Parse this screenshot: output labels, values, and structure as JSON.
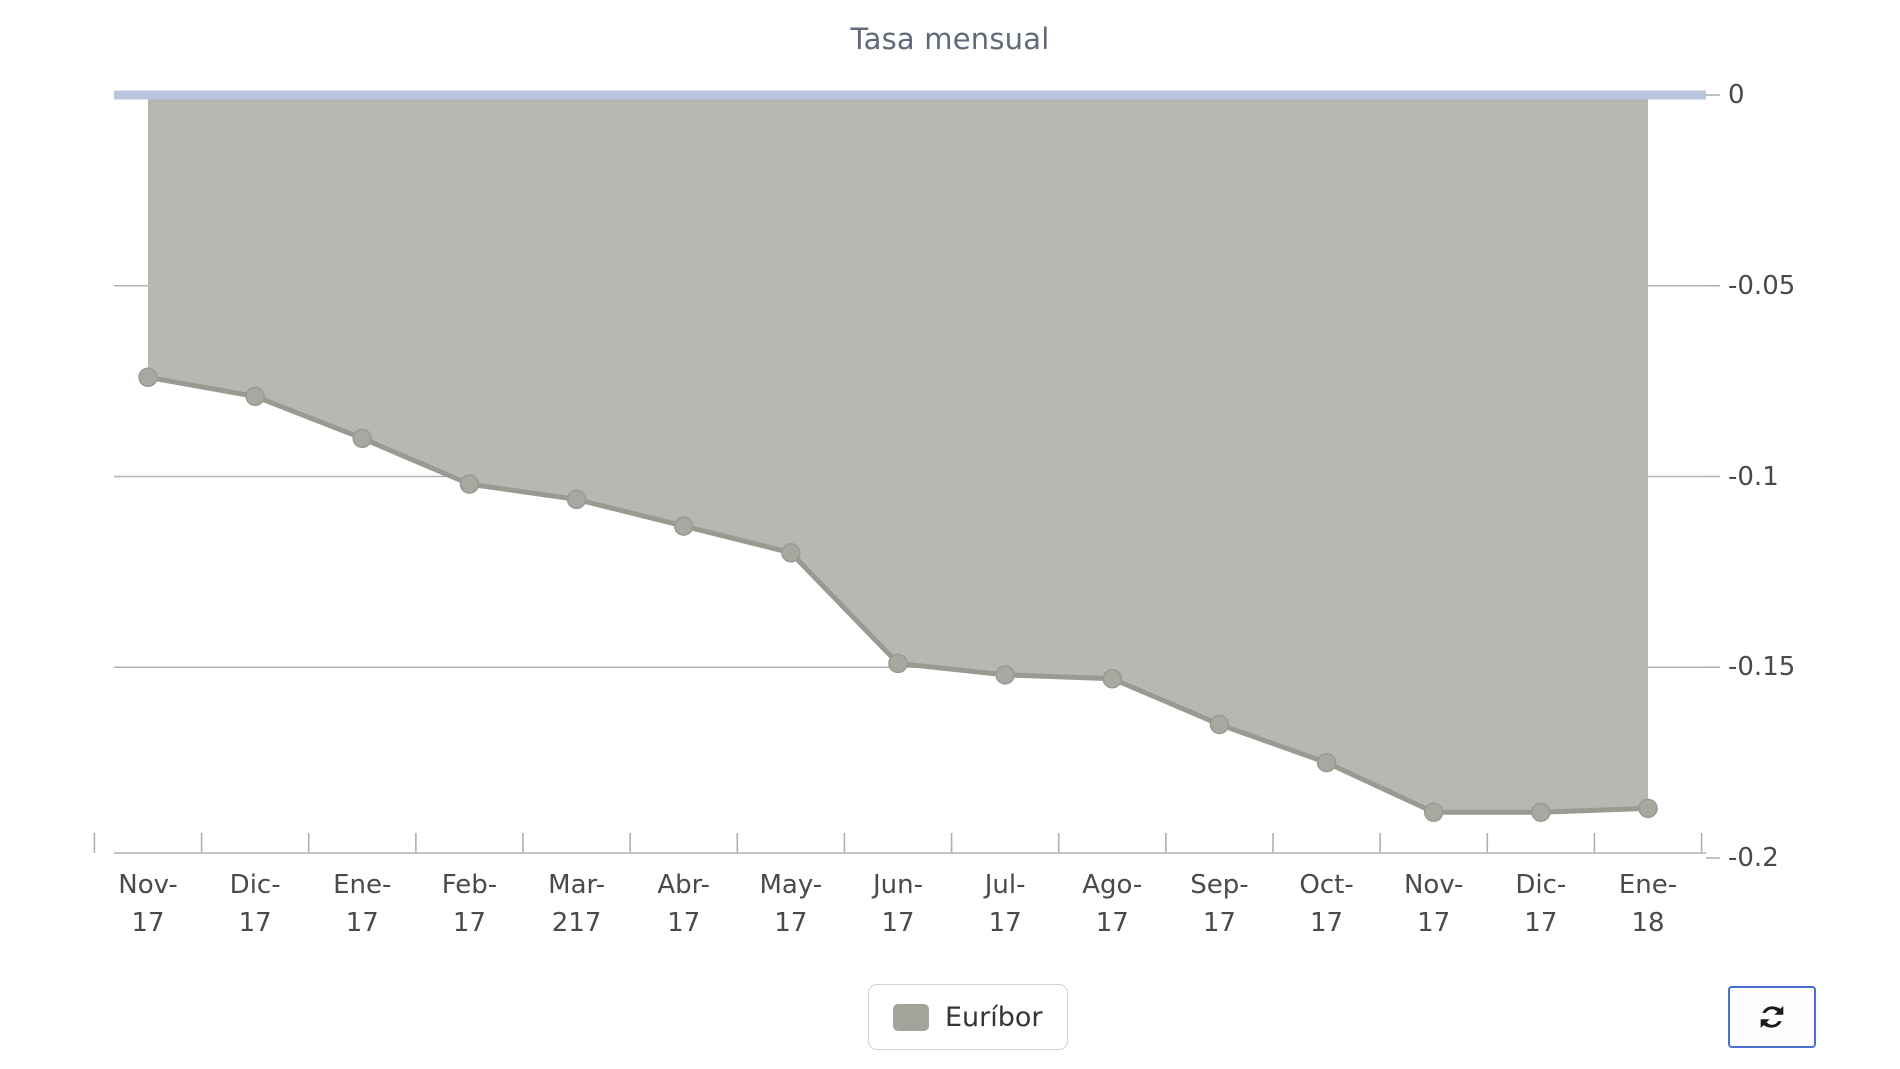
{
  "chart_data": {
    "type": "area",
    "title": "Tasa mensual",
    "xlabel": "",
    "ylabel": "",
    "grid": true,
    "legend_position": "bottom-center",
    "ylim": [
      -0.2,
      0
    ],
    "yticks": [
      "0",
      "-0.05",
      "-0.1",
      "-0.15",
      "-0.2"
    ],
    "ytick_values": [
      0,
      -0.05,
      -0.1,
      -0.15,
      -0.2
    ],
    "categories": [
      "Nov-17",
      "Dic-17",
      "Ene-17",
      "Feb-17",
      "Mar-217",
      "Abr-17",
      "May-17",
      "Jun-17",
      "Jul-17",
      "Ago-17",
      "Sep-17",
      "Oct-17",
      "Nov-17",
      "Dic-17",
      "Ene-18"
    ],
    "xtick_lines": [
      [
        "Nov-",
        "17"
      ],
      [
        "Dic-",
        "17"
      ],
      [
        "Ene-",
        "17"
      ],
      [
        "Feb-",
        "17"
      ],
      [
        "Mar-",
        "217"
      ],
      [
        "Abr-",
        "17"
      ],
      [
        "May-",
        "17"
      ],
      [
        "Jun-",
        "17"
      ],
      [
        "Jul-",
        "17"
      ],
      [
        "Ago-",
        "17"
      ],
      [
        "Sep-",
        "17"
      ],
      [
        "Oct-",
        "17"
      ],
      [
        "Nov-",
        "17"
      ],
      [
        "Dic-",
        "17"
      ],
      [
        "Ene-",
        "18"
      ]
    ],
    "series": [
      {
        "name": "Euríbor",
        "color": "#b8b8b3",
        "line_color": "#9a9a93",
        "marker_color": "#a8a8a1",
        "values": [
          -0.074,
          -0.079,
          -0.09,
          -0.102,
          -0.106,
          -0.113,
          -0.12,
          -0.149,
          -0.152,
          -0.153,
          -0.165,
          -0.175,
          -0.188,
          -0.188,
          -0.187
        ]
      }
    ],
    "zero_line_color": "#b9c4de",
    "gridline_color": "#9a9a9a",
    "axis_color": "#b0b0b0",
    "title_color": "#5f6b7a",
    "tick_label_color": "#4a4a4a"
  },
  "legend": {
    "items": [
      {
        "label": "Euríbor",
        "color": "#a3a39c"
      }
    ]
  },
  "controls": {
    "refresh_label": "",
    "refresh_icon": "refresh-icon",
    "refresh_border_color": "#4a6fd0"
  }
}
